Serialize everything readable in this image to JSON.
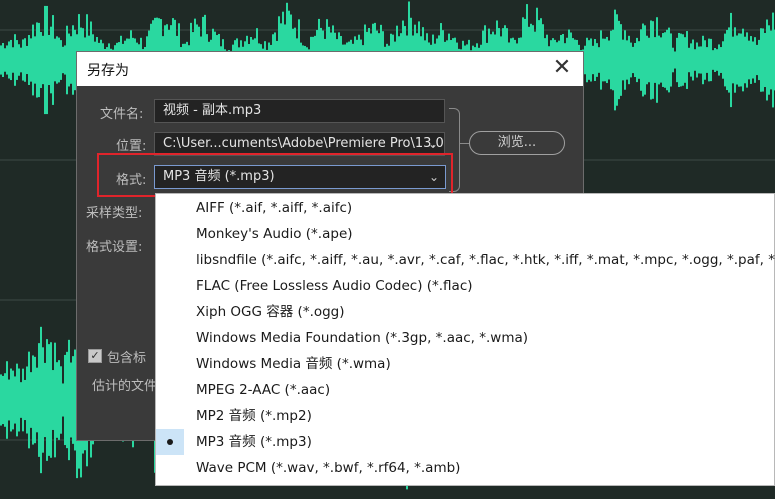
{
  "dialog": {
    "title": "另存为",
    "close_label": "✕",
    "filename_label": "文件名:",
    "filename_value": "视频 - 副本.mp3",
    "location_label": "位置:",
    "location_value": "C:\\User...cuments\\Adobe\\Premiere Pro\\13.0",
    "browse_label": "浏览...",
    "format_label": "格式:",
    "format_value": "MP3 音频 (*.mp3)",
    "sample_type_label": "采样类型:",
    "format_settings_label": "格式设置:",
    "include_label": "包含标",
    "estimate_label": "估计的文件"
  },
  "dropdown": {
    "options": [
      "AIFF (*.aif, *.aiff, *.aifc)",
      "Monkey's Audio (*.ape)",
      "libsndfile (*.aifc, *.aiff, *.au, *.avr, *.caf, *.flac, *.htk, *.iff, *.mat, *.mpc, *.ogg, *.paf, *.p",
      "FLAC (Free Lossless Audio Codec) (*.flac)",
      "Xiph OGG 容器 (*.ogg)",
      "Windows Media Foundation (*.3gp, *.aac, *.wma)",
      "Windows Media 音频 (*.wma)",
      "MPEG 2-AAC (*.aac)",
      "MP2 音频 (*.mp2)",
      "MP3 音频 (*.mp3)",
      "Wave PCM (*.wav, *.bwf, *.rf64, *.amb)"
    ],
    "selected_index": 9
  },
  "colors": {
    "waveform": "#2ad8a0",
    "background": "#1f2a26",
    "highlight_box": "#e0242b",
    "selection": "#cce4f7"
  }
}
